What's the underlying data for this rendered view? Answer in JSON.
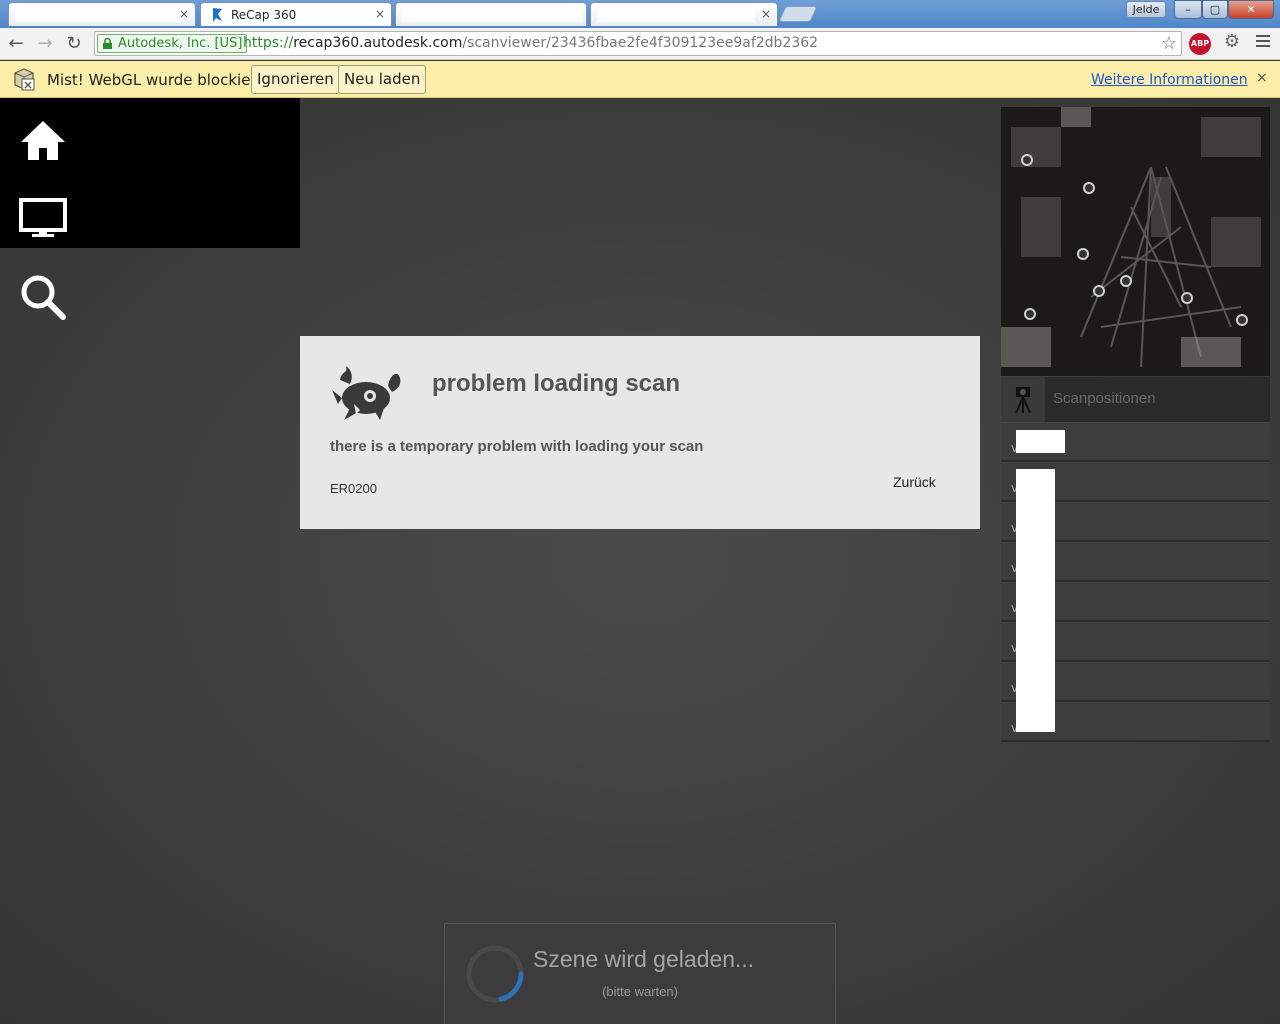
{
  "browser": {
    "tabs": [
      {
        "title": "",
        "active": false
      },
      {
        "title": "ReCap 360",
        "active": true
      },
      {
        "title": "",
        "active": false
      },
      {
        "title": "",
        "active": false
      }
    ],
    "tab_close_glyph": "×",
    "user_name": "Jelde",
    "window_buttons": {
      "minimize": "–",
      "maximize": "▢",
      "close": "✕"
    },
    "ev_label": "Autodesk, Inc. [US]",
    "url": {
      "scheme": "https://",
      "host": "recap360.autodesk.com",
      "path": "/scanviewer/23436fbae2fe4f309123ee9af2db2362"
    },
    "extensions": {
      "abp_label": "ABP"
    }
  },
  "infobar": {
    "message": "Mist! WebGL wurde blockiert.",
    "ignore_label": "Ignorieren",
    "reload_label": "Neu laden",
    "more_info_label": "Weitere Informationen",
    "close_glyph": "×"
  },
  "sidebar": {
    "items": [
      {
        "icon": "home-icon"
      },
      {
        "icon": "monitor-icon"
      },
      {
        "icon": "search-icon"
      }
    ]
  },
  "dialog": {
    "title": "problem loading scan",
    "message": "there is a temporary problem with loading your scan",
    "error_code": "ER0200",
    "back_label": "Zurück"
  },
  "scan_panel": {
    "title": "Scanpositionen",
    "rows": [
      "v",
      "v",
      "v",
      "v",
      "v",
      "v",
      "v",
      "v"
    ]
  },
  "loading": {
    "title": "Szene wird geladen...",
    "subtitle": "(bitte warten)"
  },
  "colors": {
    "viewer_bg": "#3c3c3c",
    "dialog_bg": "#e7e7e7",
    "infobar_bg": "#fbeea8",
    "spinner_accent": "#2f6fb5"
  }
}
